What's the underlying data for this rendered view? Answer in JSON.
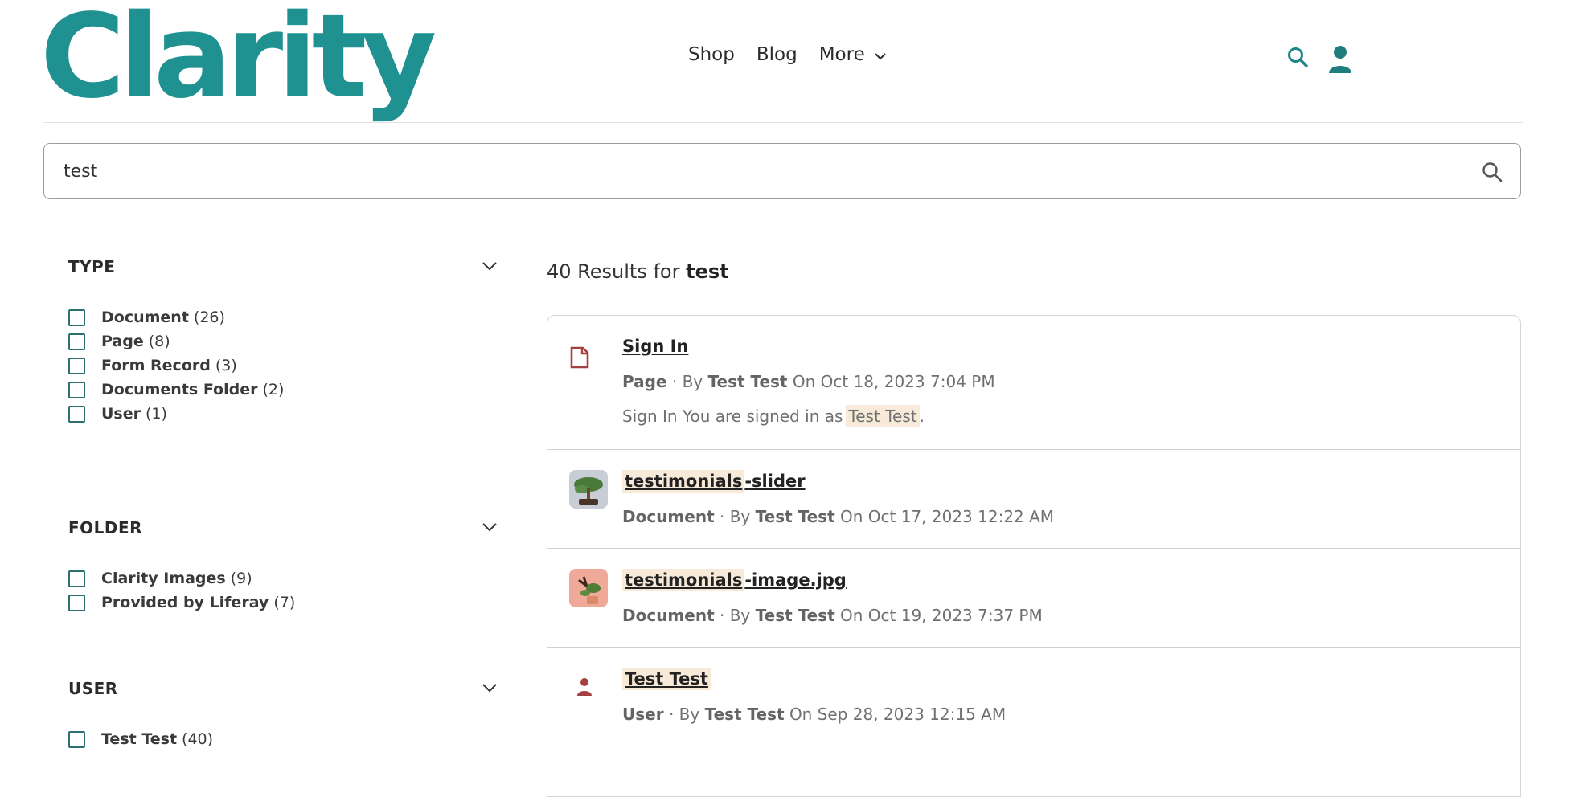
{
  "header": {
    "logo": "Clarity",
    "nav": [
      "Shop",
      "Blog",
      "More"
    ],
    "icons": [
      "search-icon",
      "user-icon",
      "chevron-down-icon"
    ],
    "accent_color": "#1f9191"
  },
  "search": {
    "value": "test"
  },
  "facets": {
    "type": {
      "title": "TYPE",
      "items": [
        {
          "label": "Document",
          "count": "(26)"
        },
        {
          "label": "Page",
          "count": "(8)"
        },
        {
          "label": "Form Record",
          "count": "(3)"
        },
        {
          "label": "Documents Folder",
          "count": "(2)"
        },
        {
          "label": "User",
          "count": "(1)"
        }
      ]
    },
    "folder": {
      "title": "FOLDER",
      "items": [
        {
          "label": "Clarity Images",
          "count": "(9)"
        },
        {
          "label": "Provided by Liferay",
          "count": "(7)"
        }
      ]
    },
    "user": {
      "title": "USER",
      "items": [
        {
          "label": "Test Test",
          "count": "(40)"
        }
      ]
    }
  },
  "results_summary": {
    "prefix": "40 Results for",
    "keyword": "test"
  },
  "results": [
    {
      "title_hl": "",
      "title_rest": "Sign In",
      "type": "Page",
      "by": "· By",
      "author": "Test Test",
      "date": "On Oct 18, 2023 7:04 PM",
      "desc_prefix": "Sign In You are signed in as",
      "desc_hl": "Test  Test",
      "desc_suffix": ".",
      "icon": "page-icon"
    },
    {
      "title_hl": "testimonials",
      "title_rest": "-slider",
      "type": "Document",
      "by": "· By",
      "author": "Test Test",
      "date": "On Oct 17, 2023 12:22 AM",
      "icon": "bonsai-thumbnail"
    },
    {
      "title_hl": "testimonials",
      "title_rest": "-image.jpg",
      "type": "Document",
      "by": "· By",
      "author": "Test Test",
      "date": "On Oct 19, 2023 7:37 PM",
      "icon": "plant-thumbnail"
    },
    {
      "title_hl": "Test  Test",
      "title_rest": "",
      "type": "User",
      "by": "· By",
      "author": "Test Test",
      "date": "On Sep 28, 2023 12:15 AM",
      "icon": "user-icon"
    }
  ]
}
